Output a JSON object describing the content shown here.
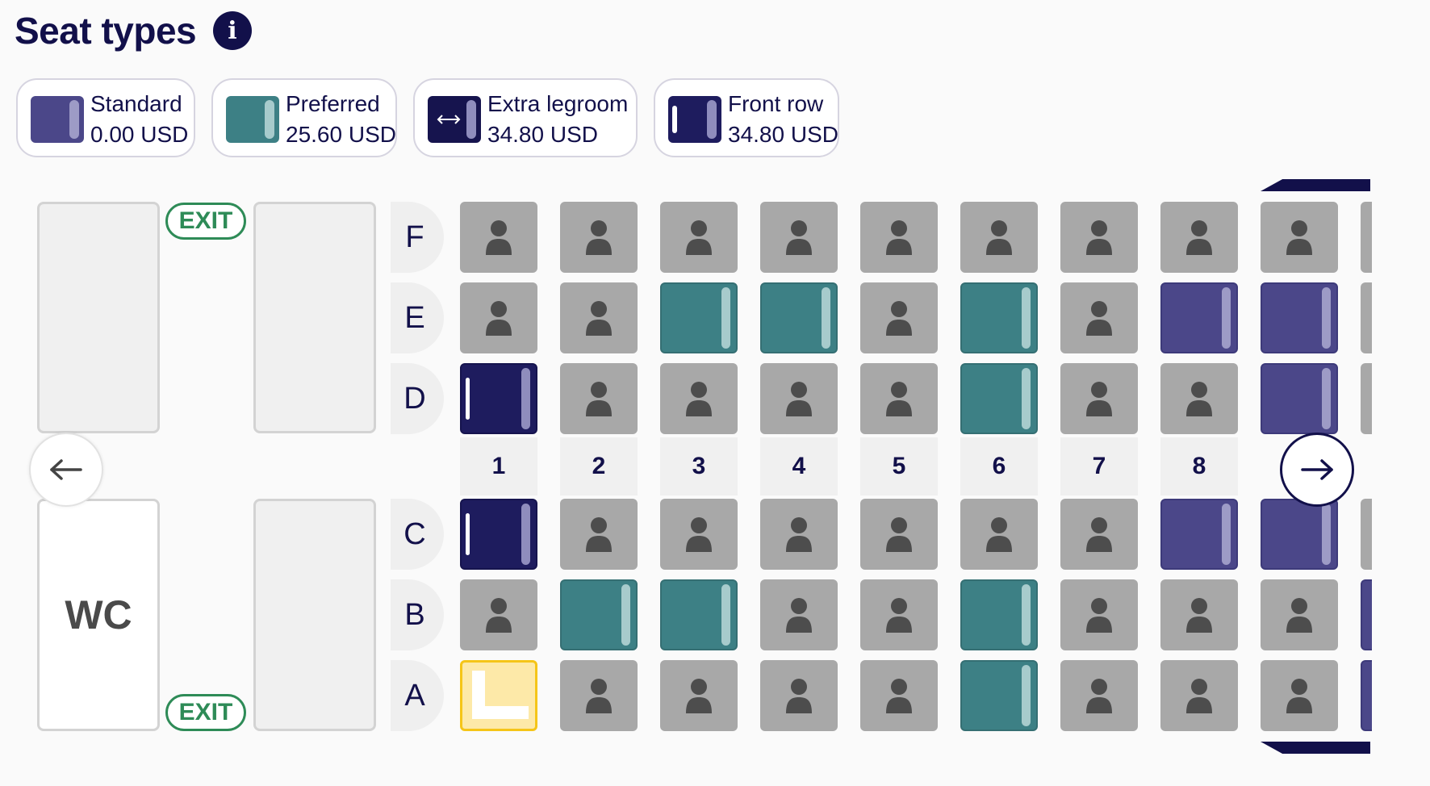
{
  "header": {
    "title": "Seat types",
    "info_icon": "info-icon"
  },
  "legend": [
    {
      "label": "Standard",
      "price": "0.00 USD",
      "type": "standard"
    },
    {
      "label": "Preferred",
      "price": "25.60 USD",
      "type": "preferred"
    },
    {
      "label": "Extra legroom",
      "price": "34.80 USD",
      "type": "extra"
    },
    {
      "label": "Front row",
      "price": "34.80 USD",
      "type": "front"
    }
  ],
  "cabin": {
    "exit_label": "EXIT",
    "wc_label": "WC",
    "row_letters_upper": [
      "F",
      "E",
      "D"
    ],
    "row_letters_lower": [
      "C",
      "B",
      "A"
    ],
    "column_numbers": [
      "1",
      "2",
      "3",
      "4",
      "5",
      "6",
      "7",
      "8"
    ],
    "seats": {
      "F": [
        "occupied",
        "occupied",
        "occupied",
        "occupied",
        "occupied",
        "occupied",
        "occupied",
        "occupied",
        "occupied"
      ],
      "E": [
        "occupied",
        "occupied",
        "preferred",
        "preferred",
        "occupied",
        "preferred",
        "occupied",
        "standard",
        "standard"
      ],
      "D": [
        "front",
        "occupied",
        "occupied",
        "occupied",
        "occupied",
        "preferred",
        "occupied",
        "occupied",
        "standard"
      ],
      "C": [
        "front",
        "occupied",
        "occupied",
        "occupied",
        "occupied",
        "occupied",
        "occupied",
        "standard",
        "standard"
      ],
      "B": [
        "occupied",
        "preferred",
        "preferred",
        "occupied",
        "occupied",
        "preferred",
        "occupied",
        "occupied",
        "occupied"
      ],
      "A": [
        "selected",
        "occupied",
        "occupied",
        "occupied",
        "occupied",
        "preferred",
        "occupied",
        "occupied",
        "occupied"
      ]
    },
    "partial_column_10": [
      "occupied",
      "occupied",
      "occupied",
      "occupied",
      "standard",
      "standard"
    ]
  },
  "navigation": {
    "prev_icon": "arrow-left-icon",
    "next_icon": "arrow-right-icon"
  },
  "colors": {
    "standard": "#4b4789",
    "preferred": "#3d8085",
    "front": "#1e1c5e",
    "occupied": "#a8a8a8",
    "selected": "#fde9a8",
    "exit": "#2e8b57",
    "brand": "#12104a"
  }
}
